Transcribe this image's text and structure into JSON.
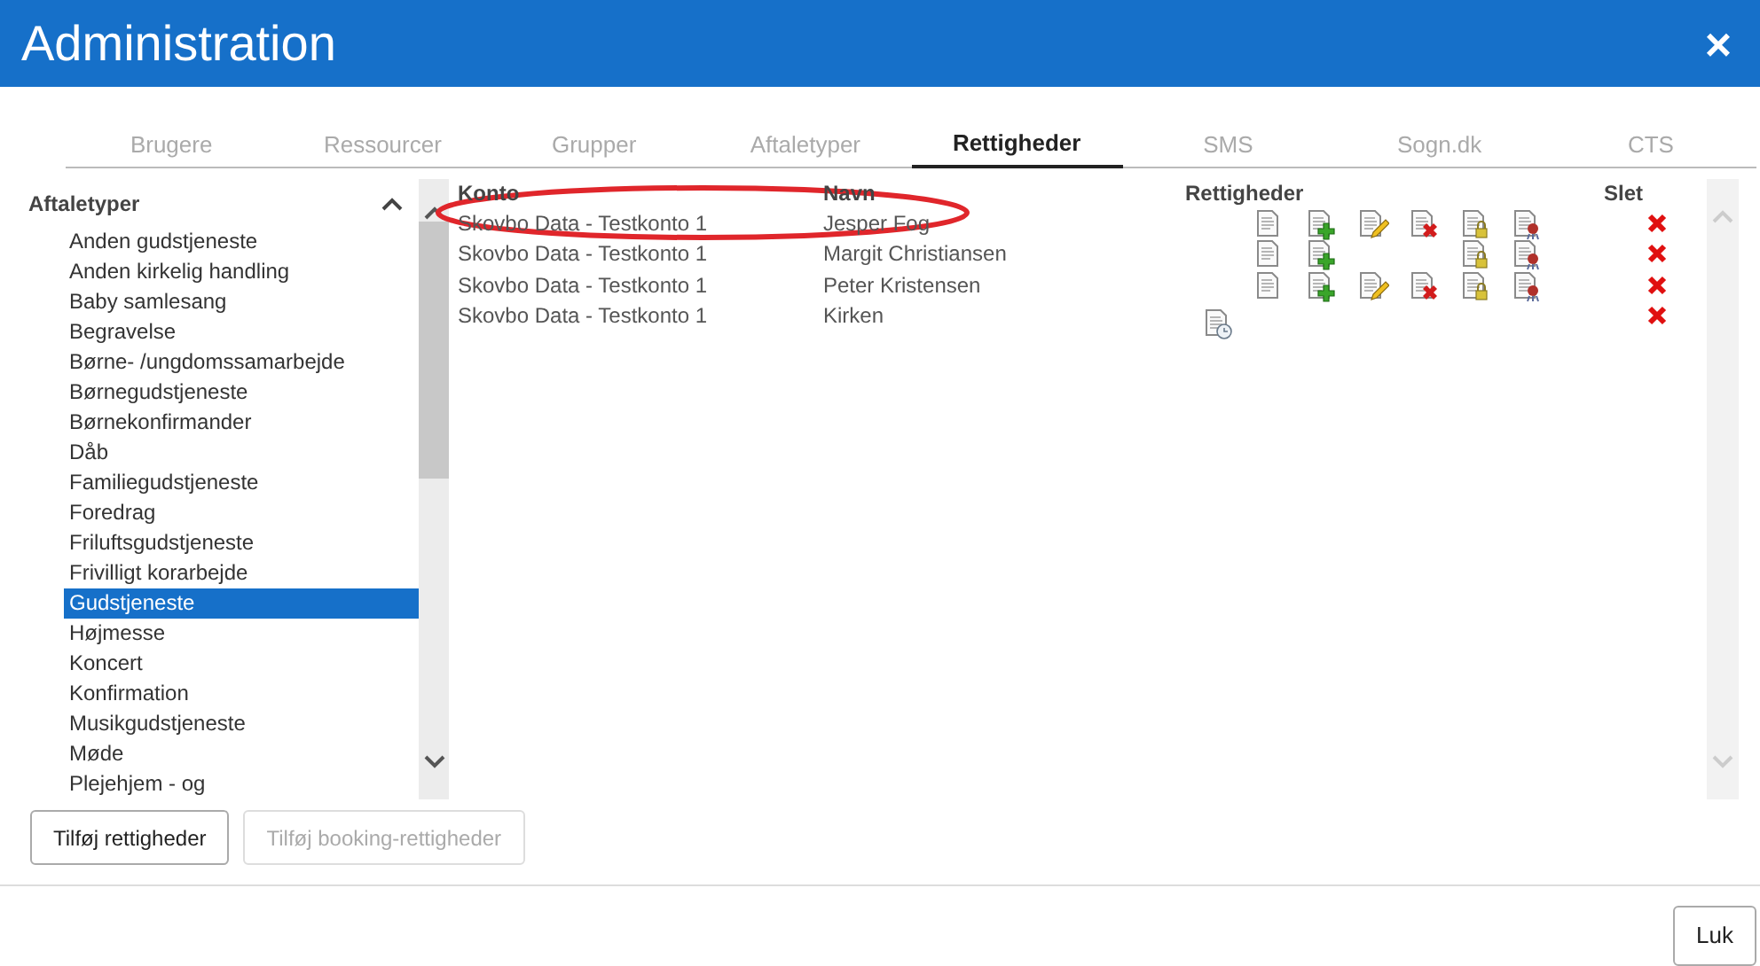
{
  "window": {
    "title": "Administration",
    "close": "×"
  },
  "tabs": [
    {
      "label": "Brugere",
      "selected": false
    },
    {
      "label": "Ressourcer",
      "selected": false
    },
    {
      "label": "Grupper",
      "selected": false
    },
    {
      "label": "Aftaletyper",
      "selected": false
    },
    {
      "label": "Rettigheder",
      "selected": true
    },
    {
      "label": "SMS",
      "selected": false
    },
    {
      "label": "Sogn.dk",
      "selected": false
    },
    {
      "label": "CTS",
      "selected": false
    }
  ],
  "sidebar": {
    "title": "Aftaletyper",
    "expanded": true,
    "items": [
      {
        "label": "Anden gudstjeneste",
        "selected": false
      },
      {
        "label": "Anden kirkelig handling",
        "selected": false
      },
      {
        "label": "Baby samlesang",
        "selected": false
      },
      {
        "label": "Begravelse",
        "selected": false
      },
      {
        "label": "Børne- /ungdomssamarbejde",
        "selected": false
      },
      {
        "label": "Børnegudstjeneste",
        "selected": false
      },
      {
        "label": "Børnekonfirmander",
        "selected": false
      },
      {
        "label": "Dåb",
        "selected": false
      },
      {
        "label": "Familiegudstjeneste",
        "selected": false
      },
      {
        "label": "Foredrag",
        "selected": false
      },
      {
        "label": "Friluftsgudstjeneste",
        "selected": false
      },
      {
        "label": "Frivilligt korarbejde",
        "selected": false
      },
      {
        "label": "Gudstjeneste",
        "selected": true
      },
      {
        "label": "Højmesse",
        "selected": false
      },
      {
        "label": "Koncert",
        "selected": false
      },
      {
        "label": "Konfirmation",
        "selected": false
      },
      {
        "label": "Musikgudstjeneste",
        "selected": false
      },
      {
        "label": "Møde",
        "selected": false
      },
      {
        "label": "Plejehjem - og",
        "selected": false
      }
    ]
  },
  "table": {
    "columns": [
      "Konto",
      "Navn",
      "Rettigheder",
      "Slet"
    ],
    "rows": [
      {
        "konto": "Skovbo Data - Testkonto 1",
        "navn": "Jesper Fog",
        "rights": {
          "schedule": false,
          "read": true,
          "add": true,
          "edit": true,
          "delete": true,
          "lock": true,
          "seal": true
        }
      },
      {
        "konto": "Skovbo Data - Testkonto 1",
        "navn": "Margit Christiansen",
        "rights": {
          "schedule": false,
          "read": true,
          "add": true,
          "edit": false,
          "delete": false,
          "lock": true,
          "seal": true
        }
      },
      {
        "konto": "Skovbo Data - Testkonto 1",
        "navn": "Peter Kristensen",
        "rights": {
          "schedule": false,
          "read": true,
          "add": true,
          "edit": true,
          "delete": true,
          "lock": true,
          "seal": true
        }
      },
      {
        "konto": "Skovbo Data - Testkonto 1",
        "navn": "Kirken",
        "rights": {
          "schedule": true,
          "read": false,
          "add": false,
          "edit": false,
          "delete": false,
          "lock": false,
          "seal": false
        }
      }
    ]
  },
  "annotation": {
    "kind": "ellipse",
    "color": "#e0262b"
  },
  "buttons": [
    {
      "label": "Tilføj rettigheder",
      "disabled": false
    },
    {
      "label": "Tilføj booking-rettigheder",
      "disabled": true
    }
  ],
  "footer": {
    "button": "Luk"
  }
}
